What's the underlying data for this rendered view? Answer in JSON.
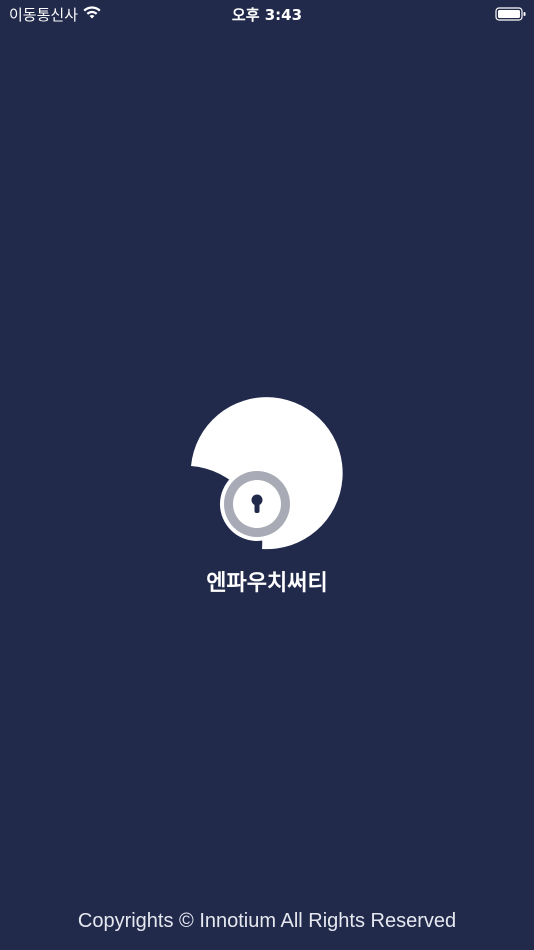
{
  "status_bar": {
    "carrier": "이동통신사",
    "time": "오후 3:43",
    "wifi_icon": "wifi-icon",
    "battery_icon": "battery-icon"
  },
  "splash": {
    "logo_icon": "open-padlock-icon",
    "app_name": "엔파우치써티",
    "copyright": "Copyrights © Innotium All Rights Reserved"
  },
  "colors": {
    "background": "#212a4b",
    "logo_white": "#ffffff",
    "lock_grey": "#a8aab5"
  }
}
